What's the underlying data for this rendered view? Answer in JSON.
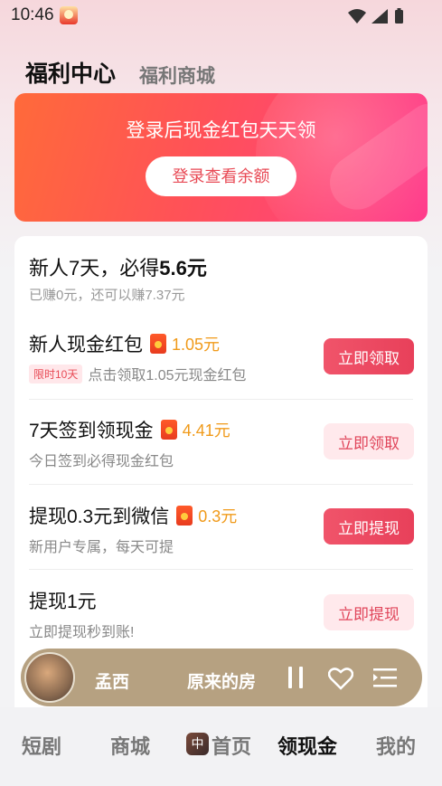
{
  "status_bar": {
    "time": "10:46"
  },
  "top_tabs": {
    "active": "福利中心",
    "other": "福利商城"
  },
  "banner": {
    "title": "登录后现金红包天天领",
    "button": "登录查看余额"
  },
  "card": {
    "title_prefix": "新人7天，必得",
    "title_amount": "5.6元",
    "subtitle": "已赚0元，还可以赚7.37元",
    "tasks": [
      {
        "name": "新人现金红包",
        "amount": "1.05元",
        "tag": "限时10天",
        "desc": "点击领取1.05元现金红包",
        "button": "立即领取",
        "button_style": "solid"
      },
      {
        "name": "7天签到领现金",
        "amount": "4.41元",
        "tag": "",
        "desc": "今日签到必得现金红包",
        "button": "立即领取",
        "button_style": "light"
      },
      {
        "name": "提现0.3元到微信",
        "amount": "0.3元",
        "tag": "",
        "desc": "新用户专属，每天可提",
        "button": "立即提现",
        "button_style": "solid"
      },
      {
        "name": "提现1元",
        "amount": "",
        "tag": "",
        "desc": "立即提现秒到账!",
        "button": "立即提现",
        "button_style": "light"
      }
    ]
  },
  "player": {
    "artist": "孟西",
    "song": "原来的房"
  },
  "bottom_nav": {
    "items": [
      "短剧",
      "商城",
      "首页",
      "领现金",
      "我的"
    ],
    "home_badge": "中",
    "active": "领现金"
  },
  "colors": {
    "accent": "#e8405a",
    "banner_start": "#ff6a3a",
    "banner_end": "#ff3c8c",
    "amount": "#f09a1a"
  }
}
